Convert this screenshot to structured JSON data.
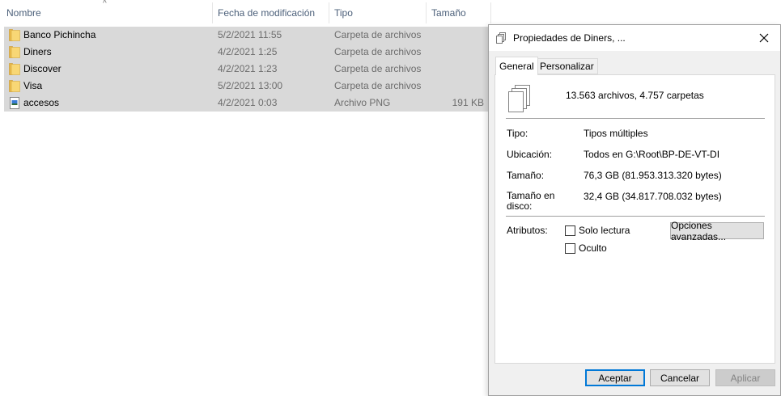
{
  "explorer": {
    "columns": {
      "name": "Nombre",
      "modified": "Fecha de modificación",
      "type": "Tipo",
      "size": "Tamaño"
    },
    "rows": [
      {
        "name": "Banco Pichincha",
        "modified": "5/2/2021 11:55",
        "type": "Carpeta de archivos",
        "size": "",
        "icon": "folder-icon"
      },
      {
        "name": "Diners",
        "modified": "4/2/2021 1:25",
        "type": "Carpeta de archivos",
        "size": "",
        "icon": "folder-icon"
      },
      {
        "name": "Discover",
        "modified": "4/2/2021 1:23",
        "type": "Carpeta de archivos",
        "size": "",
        "icon": "folder-icon"
      },
      {
        "name": "Visa",
        "modified": "5/2/2021 13:00",
        "type": "Carpeta de archivos",
        "size": "",
        "icon": "folder-icon"
      },
      {
        "name": "accesos",
        "modified": "4/2/2021 0:03",
        "type": "Archivo PNG",
        "size": "191 KB",
        "icon": "png-file-icon"
      }
    ]
  },
  "dialog": {
    "title": "Propiedades de Diners, ...",
    "close_icon": "close-icon",
    "tabs": [
      {
        "label": "General",
        "active": true
      },
      {
        "label": "Personalizar",
        "active": false
      }
    ],
    "summary": "13.563 archivos, 4.757 carpetas",
    "fields": {
      "tipo_label": "Tipo:",
      "tipo_value": "Tipos múltiples",
      "ubicacion_label": "Ubicación:",
      "ubicacion_value": "Todos en G:\\Root\\BP-DE-VT-DI",
      "tamano_label": "Tamaño:",
      "tamano_value": "76,3 GB (81.953.313.320 bytes)",
      "tamano_disco_label_1": "Tamaño en",
      "tamano_disco_label_2": "disco:",
      "tamano_disco_value": "32,4 GB (34.817.708.032 bytes)"
    },
    "attributes": {
      "label": "Atributos:",
      "read_only_label": "Solo lectura",
      "read_only_checked": false,
      "hidden_label": "Oculto",
      "hidden_checked": false,
      "advanced_button": "Opciones avanzadas..."
    },
    "buttons": {
      "ok": "Aceptar",
      "cancel": "Cancelar",
      "apply": "Aplicar"
    }
  },
  "colors": {
    "selection": "#d9d9d9",
    "header_text": "#4c607a",
    "muted_text": "#6d6d6d",
    "folder_yellow": "#f8d775",
    "accent_blue": "#0078d7"
  }
}
